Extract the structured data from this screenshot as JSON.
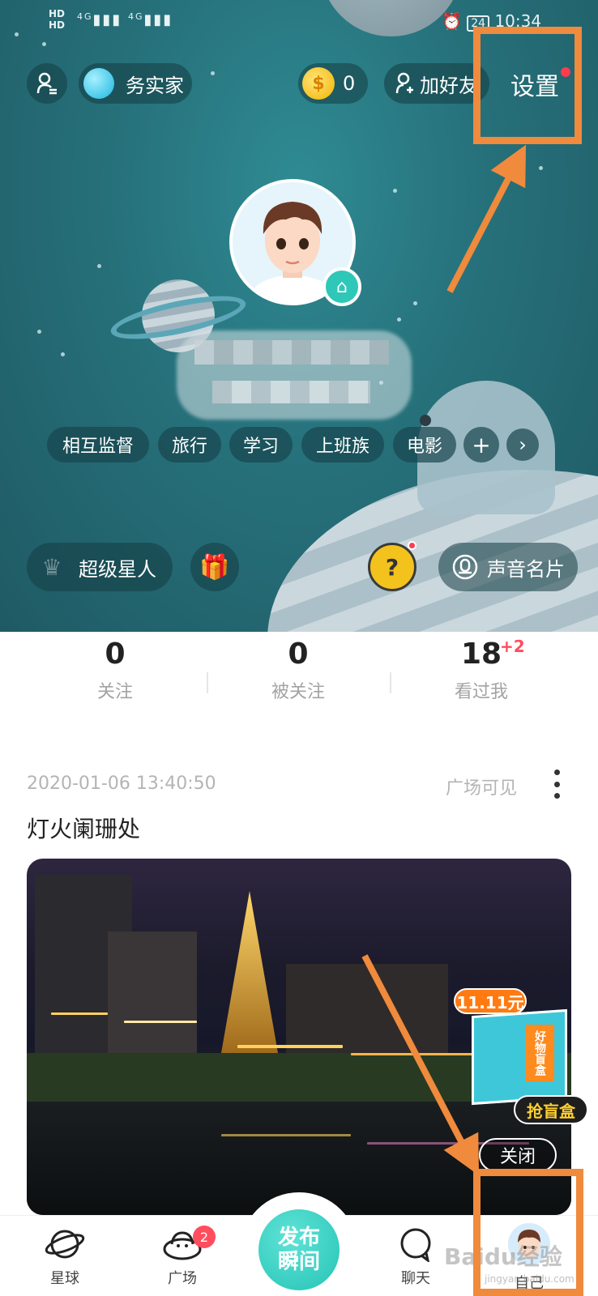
{
  "status_bar": {
    "network_line1": "HD",
    "network_line2": "HD",
    "signal_1": "4G",
    "signal_2": "4G",
    "battery": "24",
    "time": "10:34"
  },
  "header": {
    "nickname": "务实家",
    "coins": "0",
    "add_friend_label": "加好友",
    "settings_label": "设置"
  },
  "tags": [
    "相互监督",
    "旅行",
    "学习",
    "上班族",
    "电影"
  ],
  "actions": {
    "vip_label": "超级星人",
    "voice_card_label": "声音名片",
    "mystery_symbol": "?"
  },
  "stats": {
    "following": {
      "value": "0",
      "label": "关注"
    },
    "followers": {
      "value": "0",
      "label": "被关注"
    },
    "visitors": {
      "value": "18",
      "label": "看过我",
      "delta": "+2"
    }
  },
  "post": {
    "timestamp": "2020-01-06 13:40:50",
    "visibility": "广场可见",
    "title": "灯火阑珊处"
  },
  "ad": {
    "price": "11.11元",
    "box_label": "好物盲盒",
    "grab_label": "抢盲盒",
    "close_label": "关闭"
  },
  "bottom_nav": {
    "planet_label": "星球",
    "square_label": "广场",
    "square_badge": "2",
    "publish_line1": "发布",
    "publish_line2": "瞬间",
    "chat_label": "聊天",
    "me_label": "自己"
  },
  "watermark": {
    "text": "Baidu经验",
    "sub": "jingyan.baidu.com"
  },
  "colors": {
    "accent_teal": "#25c4b6",
    "annotation_orange": "#f08a3c",
    "badge_red": "#ff4d5e"
  }
}
